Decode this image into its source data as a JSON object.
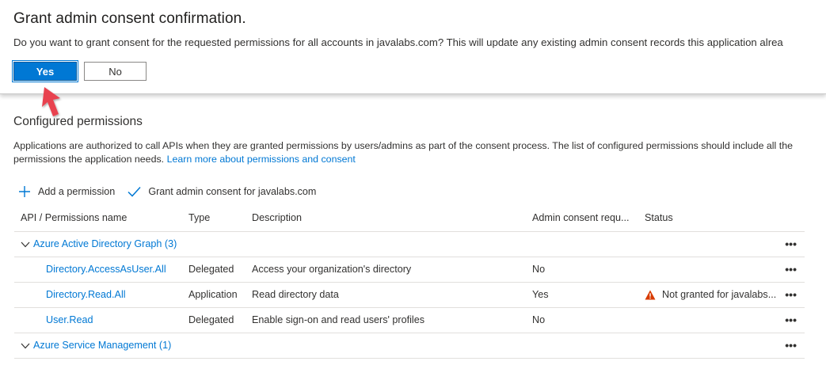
{
  "consent": {
    "title": "Grant admin consent confirmation.",
    "message": "Do you want to grant consent for the requested permissions for all accounts in javalabs.com? This will update any existing admin consent records this application alrea",
    "yes_label": "Yes",
    "no_label": "No"
  },
  "section": {
    "title": "Configured permissions",
    "description": "Applications are authorized to call APIs when they are granted permissions by users/admins as part of the consent process. The list of configured permissions should include all the permissions the application needs.",
    "learn_more": "Learn more about permissions and consent"
  },
  "toolbar": {
    "add_label": "Add a permission",
    "grant_label": "Grant admin consent for javalabs.com"
  },
  "table": {
    "headers": {
      "name": "API / Permissions name",
      "type": "Type",
      "description": "Description",
      "admin": "Admin consent requ...",
      "status": "Status"
    },
    "groups": [
      {
        "name": "Azure Active Directory Graph (3)",
        "rows": [
          {
            "name": "Directory.AccessAsUser.All",
            "type": "Delegated",
            "description": "Access your organization's directory",
            "admin": "No",
            "status": ""
          },
          {
            "name": "Directory.Read.All",
            "type": "Application",
            "description": "Read directory data",
            "admin": "Yes",
            "status": "Not granted for javalabs..."
          },
          {
            "name": "User.Read",
            "type": "Delegated",
            "description": "Enable sign-on and read users' profiles",
            "admin": "No",
            "status": ""
          }
        ]
      },
      {
        "name": "Azure Service Management (1)",
        "rows": []
      }
    ],
    "more_label": "•••"
  },
  "colors": {
    "accent": "#0078d4",
    "warning": "#d83b01",
    "arrow": "#e8434f"
  }
}
